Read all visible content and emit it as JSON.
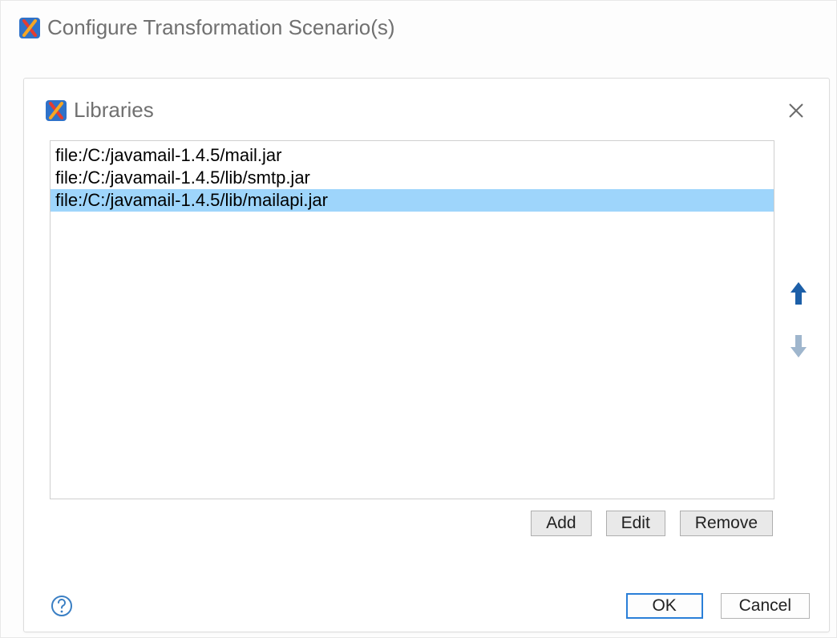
{
  "outer": {
    "title": "Configure Transformation Scenario(s)"
  },
  "dialog": {
    "title": "Libraries",
    "items": [
      {
        "path": "file:/C:/javamail-1.4.5/mail.jar",
        "selected": false
      },
      {
        "path": "file:/C:/javamail-1.4.5/lib/smtp.jar",
        "selected": false
      },
      {
        "path": "file:/C:/javamail-1.4.5/lib/mailapi.jar",
        "selected": true
      }
    ],
    "buttons": {
      "add": "Add",
      "edit": "Edit",
      "remove": "Remove",
      "ok": "OK",
      "cancel": "Cancel"
    }
  }
}
